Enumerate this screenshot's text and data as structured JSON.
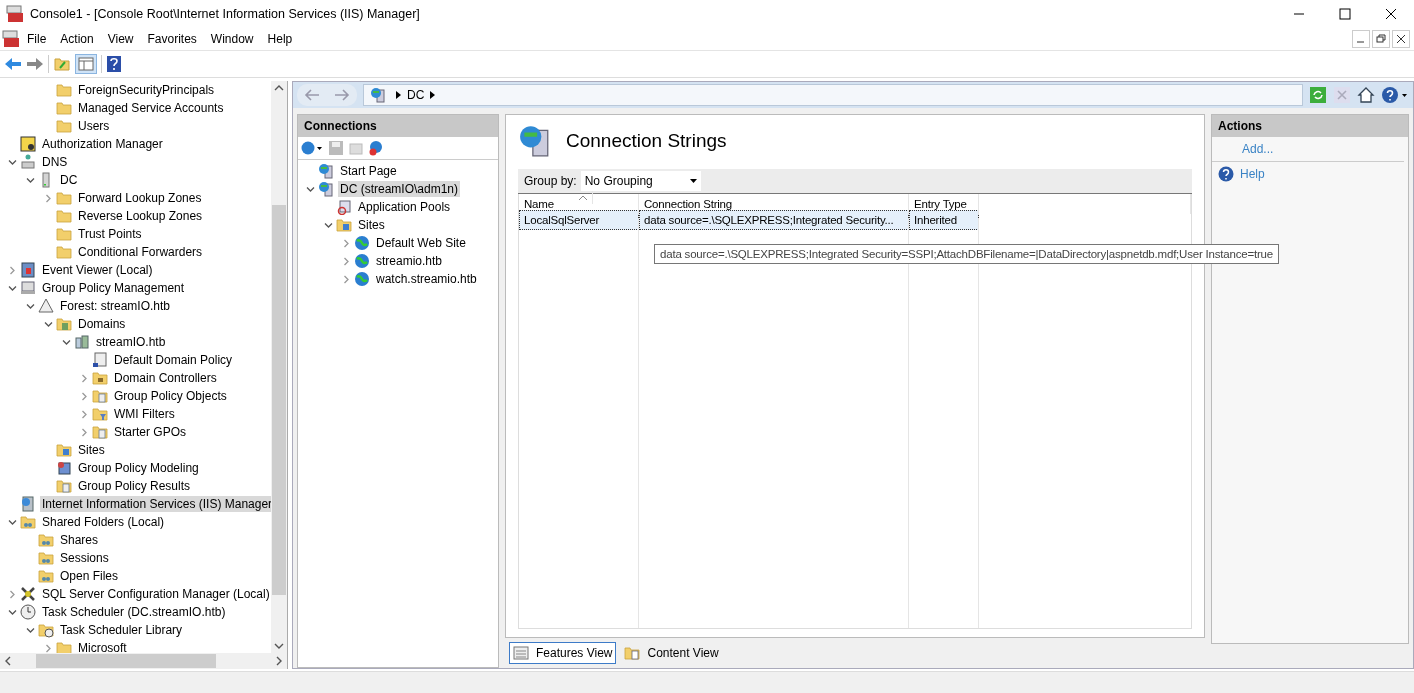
{
  "window": {
    "title": "Console1 - [Console Root\\Internet Information Services (IIS) Manager]"
  },
  "menu": [
    "File",
    "Action",
    "View",
    "Favorites",
    "Window",
    "Help"
  ],
  "tree": [
    {
      "children": [
        {
          "children": [
            {
              "label": "ForeignSecurityPrincipals",
              "kind": "folder",
              "selected": false
            },
            {
              "label": "Managed Service Accounts",
              "kind": "folder",
              "selected": false
            },
            {
              "label": "Users",
              "kind": "folder",
              "selected": false
            }
          ]
        }
      ]
    },
    {
      "label": "Authorization Manager",
      "kind": "auth",
      "selected": false
    },
    {
      "label": "DNS",
      "kind": "network",
      "expanded": true,
      "selected": false,
      "children": [
        {
          "label": "DC",
          "kind": "server",
          "expanded": true,
          "selected": false,
          "children": [
            {
              "label": "Forward Lookup Zones",
              "kind": "folder",
              "expanded": false,
              "selected": false
            },
            {
              "label": "Reverse Lookup Zones",
              "kind": "folder",
              "selected": false
            },
            {
              "label": "Trust Points",
              "kind": "folder",
              "selected": false
            },
            {
              "label": "Conditional Forwarders",
              "kind": "folder",
              "selected": false
            }
          ]
        }
      ]
    },
    {
      "label": "Event Viewer (Local)",
      "kind": "book",
      "expanded": false,
      "selected": false
    },
    {
      "label": "Group Policy Management",
      "kind": "console",
      "expanded": true,
      "selected": false,
      "children": [
        {
          "label": "Forest: streamIO.htb",
          "kind": "triangle",
          "expanded": true,
          "selected": false,
          "children": [
            {
              "label": "Domains",
              "kind": "domainfolder",
              "expanded": true,
              "selected": false,
              "children": [
                {
                  "label": "streamIO.htb",
                  "kind": "domain",
                  "expanded": true,
                  "selected": false,
                  "children": [
                    {
                      "label": "Default Domain Policy",
                      "kind": "policy",
                      "selected": false
                    },
                    {
                      "label": "Domain Controllers",
                      "kind": "ou",
                      "expanded": false,
                      "selected": false
                    },
                    {
                      "label": "Group Policy Objects",
                      "kind": "docfolder",
                      "expanded": false,
                      "selected": false
                    },
                    {
                      "label": "WMI Filters",
                      "kind": "filterfolder",
                      "expanded": false,
                      "selected": false
                    },
                    {
                      "label": "Starter GPOs",
                      "kind": "docfolder",
                      "expanded": false,
                      "selected": false
                    }
                  ]
                }
              ]
            },
            {
              "label": "Sites",
              "kind": "sitesfolder",
              "selected": false
            },
            {
              "label": "Group Policy Modeling",
              "kind": "modeling",
              "selected": false
            },
            {
              "label": "Group Policy Results",
              "kind": "docfolder",
              "selected": false
            }
          ]
        }
      ]
    },
    {
      "label": "Internet Information Services (IIS) Manager",
      "kind": "iis",
      "selected": true
    },
    {
      "label": "Shared Folders (Local)",
      "kind": "share",
      "expanded": true,
      "selected": false,
      "children": [
        {
          "label": "Shares",
          "kind": "share",
          "selected": false
        },
        {
          "label": "Sessions",
          "kind": "share",
          "selected": false
        },
        {
          "label": "Open Files",
          "kind": "share",
          "selected": false
        }
      ]
    },
    {
      "label": "SQL Server Configuration Manager (Local)",
      "kind": "tools",
      "expanded": false,
      "selected": false
    },
    {
      "label": "Task Scheduler (DC.streamIO.htb)",
      "kind": "clock",
      "expanded": true,
      "selected": false,
      "children": [
        {
          "label": "Task Scheduler Library",
          "kind": "clockfolder",
          "expanded": true,
          "selected": false,
          "children": [
            {
              "label": "Microsoft",
              "kind": "folder",
              "expanded": false,
              "selected": false
            }
          ]
        }
      ]
    }
  ],
  "iis": {
    "breadcrumb": [
      "DC"
    ],
    "connections": {
      "title": "Connections",
      "tree": [
        {
          "label": "Start Page",
          "kind": "iisserver",
          "selected": false
        },
        {
          "label": "DC (streamIO\\adm1n)",
          "kind": "iisserver",
          "expanded": true,
          "selected": true,
          "children": [
            {
              "label": "Application Pools",
              "kind": "apppool",
              "selected": false
            },
            {
              "label": "Sites",
              "kind": "sitesfolder",
              "expanded": true,
              "selected": false,
              "children": [
                {
                  "label": "Default Web Site",
                  "kind": "globe",
                  "expanded": false,
                  "selected": false
                },
                {
                  "label": "streamio.htb",
                  "kind": "globe",
                  "expanded": false,
                  "selected": false
                },
                {
                  "label": "watch.streamio.htb",
                  "kind": "globe",
                  "expanded": false,
                  "selected": false
                }
              ]
            }
          ]
        }
      ]
    },
    "feature": {
      "title": "Connection Strings",
      "group_by_label": "Group by:",
      "group_by": "No Grouping",
      "columns": [
        "Name",
        "Connection String",
        "Entry Type"
      ],
      "rows": [
        {
          "cells": [
            "LocalSqlServer",
            "data source=.\\SQLEXPRESS;Integrated Security...",
            "Inherited"
          ],
          "selected": true
        }
      ],
      "tooltip": "data source=.\\SQLEXPRESS;Integrated Security=SSPI;AttachDBFilename=|DataDirectory|aspnetdb.mdf;User Instance=true"
    },
    "actions": {
      "title": "Actions",
      "items": [
        {
          "label": "Add...",
          "kind": "link"
        },
        {
          "label": "Help",
          "kind": "help"
        }
      ]
    },
    "view_tabs": [
      {
        "label": "Features View",
        "kind": "features",
        "selected": true
      },
      {
        "label": "Content View",
        "kind": "content",
        "selected": false
      }
    ]
  }
}
